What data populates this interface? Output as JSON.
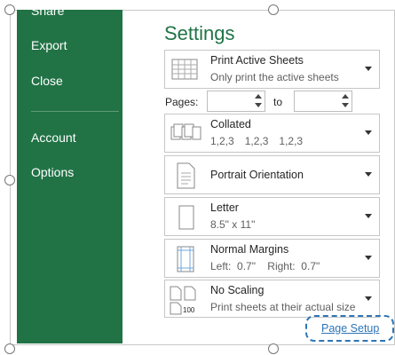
{
  "sidebar": {
    "items": [
      {
        "label": "Share",
        "id": "share"
      },
      {
        "label": "Export",
        "id": "export"
      },
      {
        "label": "Close",
        "id": "close"
      },
      {
        "label": "Account",
        "id": "account"
      },
      {
        "label": "Options",
        "id": "options"
      }
    ]
  },
  "settings": {
    "title": "Settings",
    "print_what": {
      "title": "Print Active Sheets",
      "subtitle": "Only print the active sheets",
      "icon": "sheets-icon"
    },
    "pages": {
      "label": "Pages:",
      "to_label": "to",
      "from_value": "",
      "to_value": ""
    },
    "collation": {
      "title": "Collated",
      "subtitle": [
        "1,2,3",
        "1,2,3",
        "1,2,3"
      ],
      "icon": "collated-icon"
    },
    "orientation": {
      "title": "Portrait Orientation",
      "icon": "portrait-page-icon"
    },
    "paper": {
      "title": "Letter",
      "subtitle": "8.5\" x 11\"",
      "icon": "letter-page-icon"
    },
    "margins": {
      "title": "Normal Margins",
      "subtitle": "Left:  0.7\"    Right:  0.7\"",
      "icon": "margins-icon"
    },
    "scaling": {
      "title": "No Scaling",
      "subtitle": "Print sheets at their actual size",
      "icon": "scaling-icon",
      "icon_text": "100"
    },
    "page_setup_link": "Page Setup"
  },
  "colors": {
    "accent": "#217346",
    "link": "#2e75b6"
  }
}
